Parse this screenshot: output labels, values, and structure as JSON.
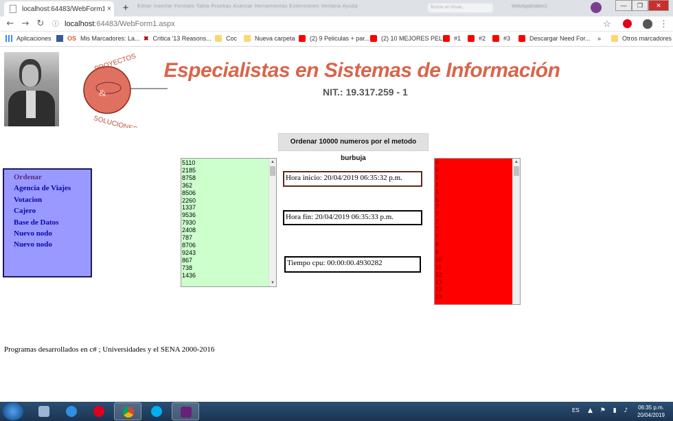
{
  "browser": {
    "tab_title": "localhost:64483/WebForm1.aspx",
    "tab_close": "×",
    "new_tab": "+",
    "blurred_menu": "Editar  Insertar  Formato  Tabla  Pruebas  Analizar  Herramientas  Extensiones  Ventana  Ayuda",
    "blurred_search": "Buscar en Visual...",
    "blurred_right": "WebApplication1",
    "minimize": "—",
    "maximize": "❐",
    "close": "✕",
    "back": "←",
    "forward": "→",
    "reload": "↻",
    "url_host": "localhost",
    "url_rest": ":64483/WebForm1.aspx",
    "star": "☆",
    "menu": "⋮"
  },
  "bookmarks": [
    {
      "label": "Aplicaciones",
      "icon": "apps-grid-icon"
    },
    {
      "label": "Mis Marcadores: La...",
      "icon": "facebook-icon"
    },
    {
      "label": "Critica '13 Reasons...",
      "icon": "x-icon"
    },
    {
      "label": "Coc",
      "icon": "folder-icon"
    },
    {
      "label": "Nueva carpeta",
      "icon": "folder-icon"
    },
    {
      "label": "(2) 9 Peliculas + par...",
      "icon": "youtube-icon"
    },
    {
      "label": "(2) 10 MEJORES PEL...",
      "icon": "youtube-icon"
    },
    {
      "label": "#1",
      "icon": "youtube-icon"
    },
    {
      "label": "#2",
      "icon": "youtube-icon"
    },
    {
      "label": "#3",
      "icon": "youtube-icon"
    },
    {
      "label": "Descargar Need For...",
      "icon": "youtube-icon"
    },
    {
      "label": "»",
      "icon": ""
    },
    {
      "label": "Otros marcadores",
      "icon": "folder-icon"
    }
  ],
  "bookmark_os_prefix": "OS",
  "page": {
    "company_title": "Especialistas en Sistemas de Información",
    "nit": "NIT.: 19.317.259 - 1",
    "sort_button_label": "Ordenar 10000 numeros por el metodo burbuja",
    "nav_items": [
      "Ordenar",
      "Agencia de Viajes",
      "Votacion",
      "Cajero",
      "Base de Datos",
      "Nuevo nodo",
      "Nuevo nodo"
    ],
    "unsorted_numbers": [
      "5110",
      "2185",
      "8758",
      "362",
      "8506",
      "2260",
      "1337",
      "9536",
      "7930",
      "2408",
      "787",
      "8706",
      "9243",
      "867",
      "738",
      "1436"
    ],
    "sorted_numbers": [
      "0",
      "0",
      "1",
      "1",
      "5",
      "6",
      "7",
      "7",
      "7",
      "7",
      "7",
      "8",
      "8",
      "10",
      "11",
      "12",
      "13",
      "13",
      "13"
    ],
    "start_time": "Hora inicio: 20/04/2019 06:35:32 p.m.",
    "end_time": "Hora fin: 20/04/2019 06:35:33 p.m.",
    "cpu_time": "Tiempo cpu: 00:00:00.4930282",
    "footer": "Programas desarrollados en c# ; Universidades y el SENA 2000-2016",
    "logo_text_top": "PROYECTOS",
    "logo_text_bottom": "SOLUCIONES",
    "logo_ampersand": "&"
  },
  "taskbar": {
    "language": "ES",
    "clock_time": "06:35 p.m.",
    "clock_date": "20/04/2019",
    "apps": [
      "file-explorer-icon",
      "calculator-icon",
      "internet-explorer-icon",
      "opera-icon",
      "chrome-icon",
      "photos-icon",
      "skype-icon",
      "visual-studio-icon"
    ]
  },
  "colors": {
    "title": "#d9654b",
    "nav_bg": "#9999ff",
    "nav_text": "#0a0aa8",
    "unsorted_bg": "#ccffcc",
    "sorted_bg": "#ff0000"
  }
}
